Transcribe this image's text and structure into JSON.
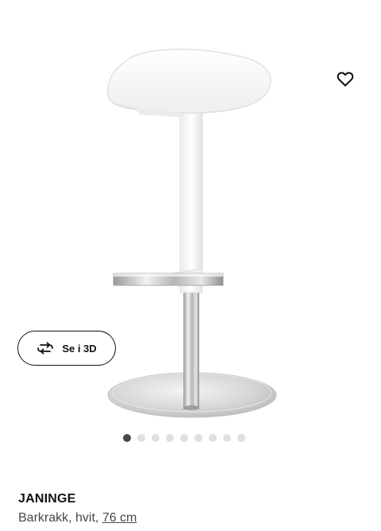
{
  "product": {
    "name": "JANINGE",
    "description": "Barkrakk, hvit, ",
    "size_link": "76 cm"
  },
  "gallery": {
    "view_3d_label": "Se i 3D",
    "slide_count": 9,
    "active_slide": 1
  },
  "icons": {
    "favorite": "heart-icon",
    "view_3d": "rotate-3d-icon"
  }
}
